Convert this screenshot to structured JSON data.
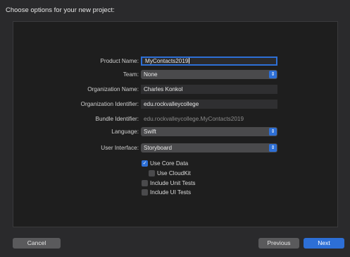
{
  "header": {
    "title": "Choose options for your new project:"
  },
  "form": {
    "product_name": {
      "label": "Product Name:",
      "value": "MyContacts2019"
    },
    "team": {
      "label": "Team:",
      "value": "None"
    },
    "organization_name": {
      "label": "Organization Name:",
      "value": "Charles Konkol"
    },
    "organization_identifier": {
      "label": "Organization Identifier:",
      "value": "edu.rockvalleycollege"
    },
    "bundle_identifier": {
      "label": "Bundle Identifier:",
      "value": "edu.rockvalleycollege.MyContacts2019"
    },
    "language": {
      "label": "Language:",
      "value": "Swift"
    },
    "user_interface": {
      "label": "User Interface:",
      "value": "Storyboard"
    },
    "checks": {
      "use_core_data": {
        "label": "Use Core Data",
        "checked": true
      },
      "use_cloudkit": {
        "label": "Use CloudKit",
        "checked": false
      },
      "include_unit_tests": {
        "label": "Include Unit Tests",
        "checked": false
      },
      "include_ui_tests": {
        "label": "Include UI Tests",
        "checked": false
      }
    }
  },
  "footer": {
    "cancel_label": "Cancel",
    "previous_label": "Previous",
    "next_label": "Next"
  },
  "colors": {
    "accent": "#2d6fd6",
    "background": "#1e1e1e"
  }
}
